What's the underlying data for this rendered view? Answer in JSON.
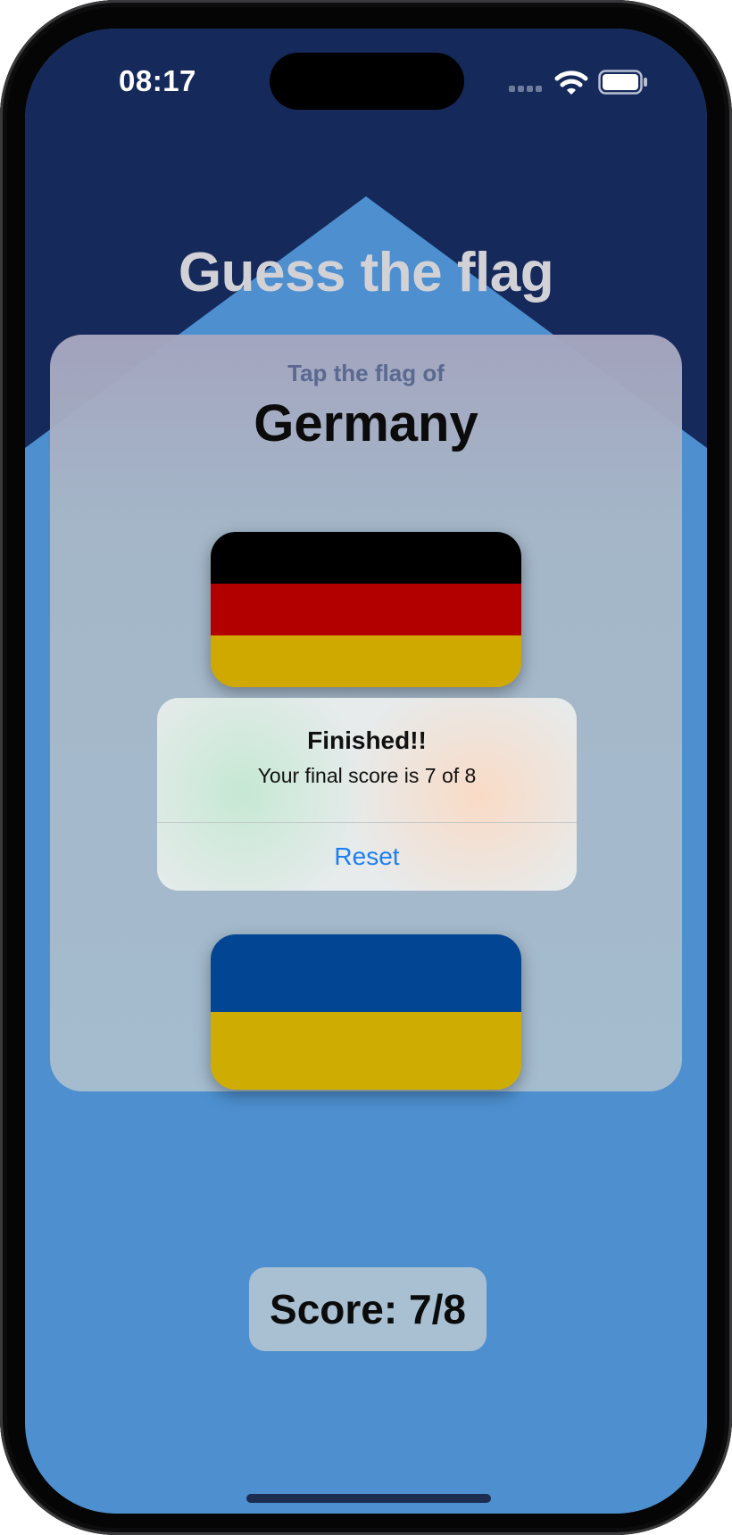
{
  "status_bar": {
    "time": "08:17"
  },
  "game": {
    "title": "Guess the flag",
    "prompt": "Tap the flag of",
    "country": "Germany",
    "flags": [
      {
        "name": "germany",
        "stripes": [
          "#000000",
          "#b20000",
          "#cfa800"
        ]
      },
      {
        "name": "ukraine",
        "stripes": [
          "#024593",
          "#cfac02"
        ]
      }
    ]
  },
  "alert": {
    "title": "Finished!!",
    "message": "Your final score is 7 of 8",
    "button_label": "Reset"
  },
  "score": {
    "label": "Score: 7/8"
  },
  "colors": {
    "background_top": "#15295b",
    "background_bottom": "#4d8fcf",
    "accent": "#1c7ff2"
  }
}
